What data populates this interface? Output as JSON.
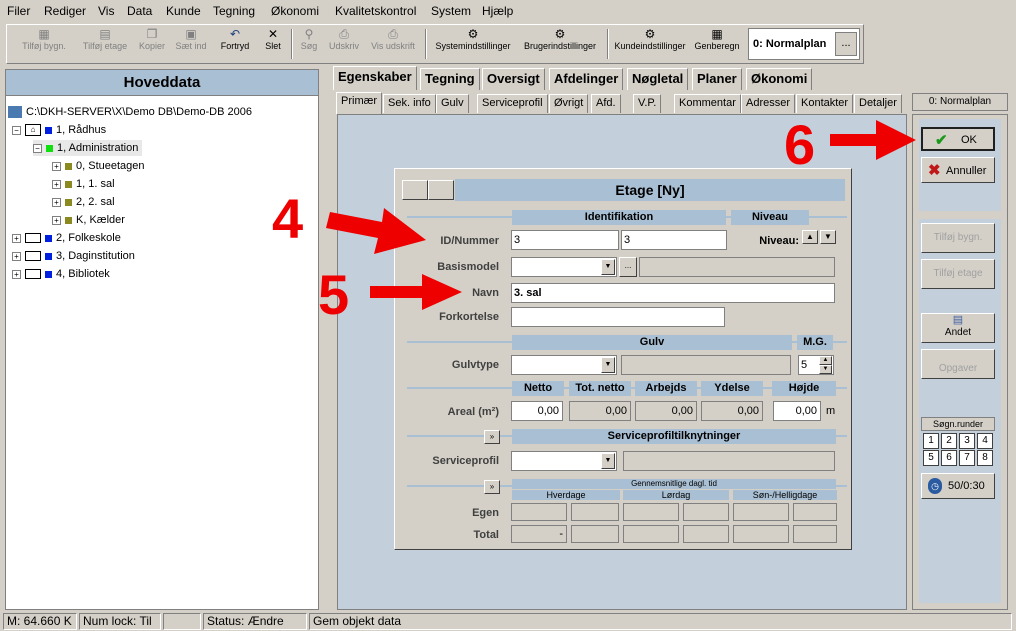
{
  "menu": [
    "Filer",
    "Rediger",
    "Vis",
    "Data",
    "Kunde",
    "Tegning",
    "Økonomi",
    "Kvalitetskontrol",
    "System",
    "Hjælp"
  ],
  "toolbar": {
    "buttons": [
      {
        "label": "Tilføj bygn.",
        "icon": "add-building-icon"
      },
      {
        "label": "Tilføj etage",
        "icon": "add-floor-icon"
      },
      {
        "label": "Kopier",
        "icon": "copy-icon"
      },
      {
        "label": "Sæt ind",
        "icon": "paste-icon"
      },
      {
        "label": "Fortryd",
        "icon": "undo-icon"
      },
      {
        "label": "Slet",
        "icon": "delete-icon"
      },
      {
        "label": "Søg",
        "icon": "search-icon"
      },
      {
        "label": "Udskriv",
        "icon": "print-icon"
      },
      {
        "label": "Vis udskrift",
        "icon": "print-preview-icon"
      },
      {
        "label": "Systemindstillinger",
        "icon": "system-settings-icon"
      },
      {
        "label": "Brugerindstillinger",
        "icon": "user-settings-icon"
      },
      {
        "label": "Kundeindstillinger",
        "icon": "customer-settings-icon"
      },
      {
        "label": "Genberegn",
        "icon": "recalculate-icon"
      }
    ],
    "plan": "0: Normalplan",
    "plan_dots": "..."
  },
  "left": {
    "title": "Hoveddata",
    "root": "C:\\DKH-SERVER\\X\\Demo DB\\Demo-DB 2006",
    "nodes": [
      "1, Rådhus",
      "1, Administration",
      "0, Stueetagen",
      "1, 1. sal",
      "2, 2. sal",
      "K, Kælder",
      "2, Folkeskole",
      "3, Daginstitution",
      "4, Bibliotek"
    ]
  },
  "tabs": {
    "main": [
      "Egenskaber",
      "Tegning",
      "Oversigt",
      "Afdelinger",
      "Nøgletal",
      "Planer",
      "Økonomi"
    ],
    "sub": [
      "Primær",
      "Sek. info",
      "Gulv",
      "Serviceprofil",
      "Øvrigt",
      "Afd.",
      "V.P.",
      "Kommentar",
      "Adresser",
      "Kontakter",
      "Detaljer"
    ],
    "plan_label": "0: Normalplan"
  },
  "right": {
    "ok": "OK",
    "cancel": "Annuller",
    "add_building": "Tilføj bygn.",
    "add_floor": "Tilføj etage",
    "other": "Andet",
    "tasks": "Opgaver",
    "soign_label": "Søgn.runder",
    "soign_numbers": [
      "1",
      "2",
      "3",
      "4",
      "5",
      "6",
      "7",
      "8"
    ],
    "counter": "50/0:30"
  },
  "dialog": {
    "title": "Etage [Ny]",
    "identifikation": "Identifikation",
    "niveau_head": "Niveau",
    "id_label": "ID/Nummer",
    "id_value": "3",
    "nummer_value": "3",
    "niveau_label": "Niveau:",
    "basismodel_label": "Basismodel",
    "basismodel_btn": "...",
    "navn_label": "Navn",
    "navn_value": "3. sal",
    "forkortelse_label": "Forkortelse",
    "gulv_head": "Gulv",
    "mg_head": "M.G.",
    "gulvtype_label": "Gulvtype",
    "mg_value": "5",
    "netto_head": "Netto",
    "totnetto_head": "Tot. netto",
    "arbejds_head": "Arbejds",
    "ydelse_head": "Ydelse",
    "hojde_head": "Højde",
    "areal_label": "Areal (m²)",
    "netto_value": "0,00",
    "totnetto_value": "0,00",
    "arbejds_value": "0,00",
    "ydelse_value": "0,00",
    "hojde_value": "0,00",
    "hojde_unit": "m",
    "expand_btn": "»",
    "service_head": "Serviceprofiltilknytninger",
    "serviceprofil_label": "Serviceprofil",
    "daily_head": "Gennemsnitlige dagl. tid",
    "hverdage": "Hverdage",
    "lordag": "Lørdag",
    "sonhelligdage": "Søn-/Helligdage",
    "egen_label": "Egen",
    "total_label": "Total",
    "total_dash": "-"
  },
  "annotations": [
    "4",
    "5",
    "6"
  ],
  "status": {
    "memory": "M: 64.660 K",
    "numlock": "Num lock: Til",
    "status": "Status: Ændre",
    "message": "Gem objekt data"
  }
}
